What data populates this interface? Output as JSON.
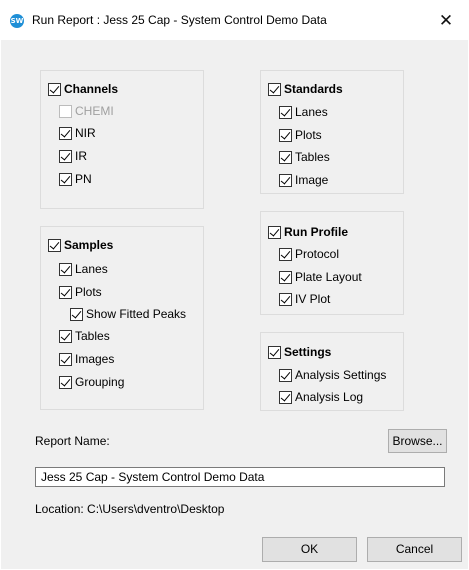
{
  "window": {
    "title": "Run Report : Jess 25 Cap - System Control Demo Data",
    "close_glyph": "✕",
    "app_icon_text": "SW"
  },
  "channels": {
    "header": "Channels",
    "items": [
      "CHEMI",
      "NIR",
      "IR",
      "PN"
    ]
  },
  "samples": {
    "header": "Samples",
    "items": [
      "Lanes",
      "Plots",
      "Show Fitted Peaks",
      "Tables",
      "Images",
      "Grouping"
    ]
  },
  "standards": {
    "header": "Standards",
    "items": [
      "Lanes",
      "Plots",
      "Tables",
      "Image"
    ]
  },
  "run_profile": {
    "header": "Run Profile",
    "items": [
      "Protocol",
      "Plate Layout",
      "IV Plot"
    ]
  },
  "settings": {
    "header": "Settings",
    "items": [
      "Analysis Settings",
      "Analysis Log"
    ]
  },
  "report": {
    "name_label": "Report Name:",
    "browse_label": "Browse...",
    "name_value": "Jess 25 Cap - System Control Demo Data",
    "location_text": "Location: C:\\Users\\dventro\\Desktop"
  },
  "buttons": {
    "ok": "OK",
    "cancel": "Cancel"
  }
}
